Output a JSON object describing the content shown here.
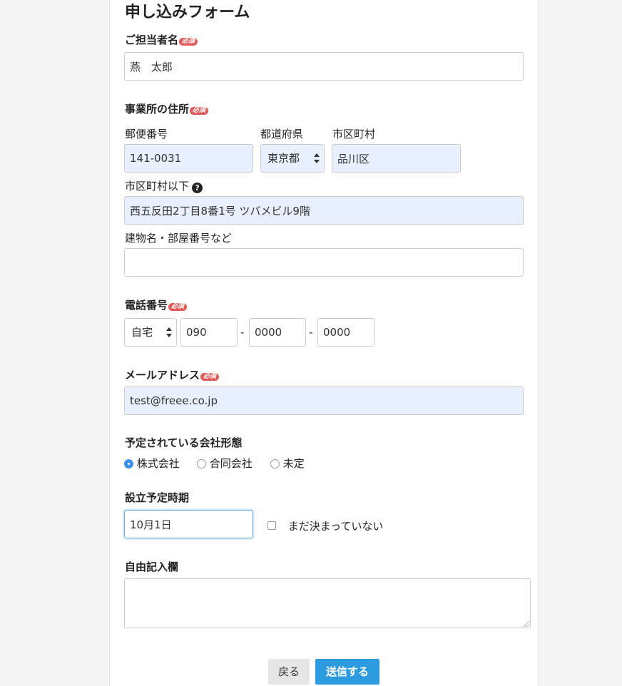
{
  "form": {
    "title": "申し込みフォーム",
    "required_badge": "必須",
    "contact": {
      "label": "ご担当者名",
      "value": "燕　太郎"
    },
    "address": {
      "label": "事業所の住所",
      "postal_label": "郵便番号",
      "postal_value": "141-0031",
      "prefecture_label": "都道府県",
      "prefecture_value": "東京都",
      "city_label": "市区町村",
      "city_value": "品川区",
      "street_label": "市区町村以下",
      "street_value": "西五反田2丁目8番1号 ツバメビル9階",
      "building_label": "建物名・部屋番号など",
      "building_value": ""
    },
    "phone": {
      "label": "電話番号",
      "type_value": "自宅",
      "part1": "090",
      "part2": "0000",
      "part3": "0000",
      "separator": "-"
    },
    "email": {
      "label": "メールアドレス",
      "value": "test@freee.co.jp"
    },
    "company_type": {
      "label": "予定されている会社形態",
      "options": [
        "株式会社",
        "合同会社",
        "未定"
      ],
      "selected": "株式会社"
    },
    "founding": {
      "label": "設立予定時期",
      "value": "10月1日",
      "undecided_label": "まだ決まっていない"
    },
    "notes": {
      "label": "自由記入欄",
      "value": ""
    },
    "buttons": {
      "back": "戻る",
      "submit": "送信する"
    }
  },
  "colors": {
    "accent": "#2d9be0",
    "required": "#e05a5a",
    "autofill": "#e8f0fe"
  }
}
